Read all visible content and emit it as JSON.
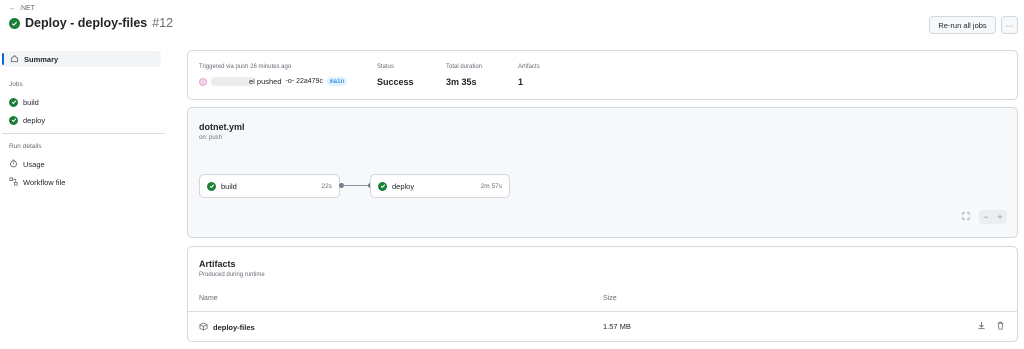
{
  "header": {
    "back_label": ".NET",
    "title": "Deploy - deploy-files",
    "run_number": "#12",
    "rerun_label": "Re-run all jobs",
    "more_label": "···"
  },
  "sidebar": {
    "summary_label": "Summary",
    "jobs_heading": "Jobs",
    "jobs": [
      {
        "label": "build"
      },
      {
        "label": "deploy"
      }
    ],
    "run_details_heading": "Run details",
    "usage_label": "Usage",
    "workflow_file_label": "Workflow file"
  },
  "run_info": {
    "triggered_label": "Triggered via push 26 minutes ago",
    "pushed_suffix": "el pushed",
    "commit": "22a479c",
    "branch": "main",
    "status_label": "Status",
    "status_value": "Success",
    "duration_label": "Total duration",
    "duration_value": "3m 35s",
    "artifacts_label": "Artifacts",
    "artifacts_value": "1"
  },
  "workflow": {
    "file": "dotnet.yml",
    "trigger": "on: push",
    "jobs": [
      {
        "name": "build",
        "duration": "22s"
      },
      {
        "name": "deploy",
        "duration": "2m 57s"
      }
    ],
    "zoom_minus": "−",
    "zoom_plus": "+"
  },
  "artifacts": {
    "title": "Artifacts",
    "subtitle": "Produced during runtime",
    "col_name": "Name",
    "col_size": "Size",
    "rows": [
      {
        "name": "deploy-files",
        "size": "1.57 MB"
      }
    ]
  },
  "colors": {
    "success": "#1a7f37",
    "accent": "#0969da"
  }
}
